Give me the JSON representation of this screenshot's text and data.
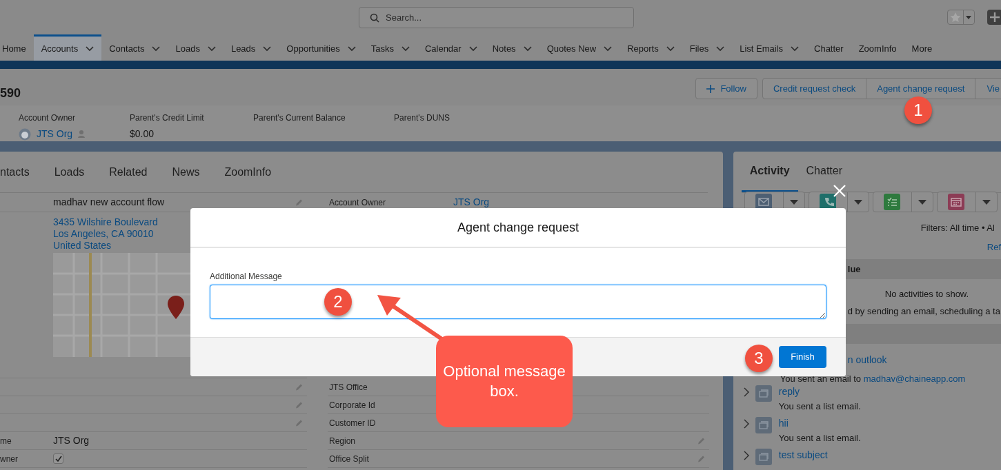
{
  "header": {
    "search": {
      "placeholder": "Search..."
    }
  },
  "nav": {
    "tabs": [
      {
        "label": "Home",
        "dropdown": false,
        "selected": false
      },
      {
        "label": "Accounts",
        "dropdown": true,
        "selected": true
      },
      {
        "label": "Contacts",
        "dropdown": true,
        "selected": false
      },
      {
        "label": "Loads",
        "dropdown": true,
        "selected": false
      },
      {
        "label": "Leads",
        "dropdown": true,
        "selected": false
      },
      {
        "label": "Opportunities",
        "dropdown": true,
        "selected": false
      },
      {
        "label": "Tasks",
        "dropdown": true,
        "selected": false
      },
      {
        "label": "Calendar",
        "dropdown": true,
        "selected": false
      },
      {
        "label": "Notes",
        "dropdown": true,
        "selected": false
      },
      {
        "label": "Quotes New",
        "dropdown": true,
        "selected": false
      },
      {
        "label": "Reports",
        "dropdown": true,
        "selected": false
      },
      {
        "label": "Files",
        "dropdown": true,
        "selected": false
      },
      {
        "label": "List Emails",
        "dropdown": true,
        "selected": false
      },
      {
        "label": "Chatter",
        "dropdown": false,
        "selected": false
      },
      {
        "label": "ZoomInfo",
        "dropdown": false,
        "selected": false
      },
      {
        "label": "More",
        "dropdown": false,
        "selected": false
      }
    ]
  },
  "record": {
    "title": "590",
    "actions": [
      {
        "label": "Follow",
        "kind": "follow"
      },
      {
        "label": "Credit request check",
        "kind": "action"
      },
      {
        "label": "Agent change request",
        "kind": "action"
      },
      {
        "label": "Vie",
        "kind": "action"
      }
    ],
    "highlights": [
      {
        "label": "Account Owner",
        "value": "JTS Org",
        "kind": "owner"
      },
      {
        "label": "Parent's Credit Limit",
        "value": "$0.00",
        "kind": "text"
      },
      {
        "label": "Parent's Current Balance",
        "kind": "text"
      },
      {
        "label": "Parent's DUNS",
        "kind": "text"
      }
    ]
  },
  "detail": {
    "tabs": [
      {
        "label": "ntacts",
        "selected": false
      },
      {
        "label": "Loads",
        "selected": false
      },
      {
        "label": "Related",
        "selected": false
      },
      {
        "label": "News",
        "selected": false
      },
      {
        "label": "ZoomInfo",
        "selected": false
      }
    ],
    "left_fields": [
      {
        "kind": "text",
        "value": "madhav new account flow",
        "editable": true
      },
      {
        "kind": "address",
        "lines": [
          "3435 Wilshire Boulevard",
          "Los Angeles, CA 90010",
          "United States"
        ]
      },
      {
        "kind": "text",
        "editable": true
      },
      {
        "kind": "text",
        "editable": true
      },
      {
        "kind": "text",
        "editable": true
      },
      {
        "kind": "text",
        "label": "me",
        "value": "JTS Org"
      },
      {
        "kind": "checkbox",
        "label": "wner",
        "checked": true
      }
    ],
    "right_fields": [
      {
        "kind": "link",
        "label": "Account Owner",
        "value": "JTS Org"
      },
      {
        "kind": "text",
        "label": "JTS Office"
      },
      {
        "kind": "text",
        "label": "Corporate Id"
      },
      {
        "kind": "text",
        "label": "Customer ID"
      },
      {
        "kind": "text",
        "label": "Region",
        "editable": true
      },
      {
        "kind": "text",
        "label": "Office Split",
        "editable": true
      }
    ]
  },
  "activity": {
    "tabs": [
      {
        "label": "Activity",
        "selected": true
      },
      {
        "label": "Chatter",
        "selected": false
      }
    ],
    "quick_actions": [
      {
        "kind": "email"
      },
      {
        "kind": "call"
      },
      {
        "kind": "task"
      },
      {
        "kind": "event"
      }
    ],
    "filters": "Filters: All time • Al",
    "refresh": "Ref",
    "section": "lue",
    "empty_title": "No activities to show.",
    "empty_hint": "d by sending an email, scheduling a ta",
    "items": [
      {
        "kind": "email",
        "title": "n outlook",
        "text": "You sent an email to ",
        "link": "madhav@chaineapp.com"
      },
      {
        "kind": "list_email",
        "title": "reply",
        "text": "You sent a list email."
      },
      {
        "kind": "list_email",
        "title": "hii",
        "text": "You sent a list email."
      },
      {
        "kind": "list_email",
        "title": "test subject"
      }
    ]
  },
  "modal": {
    "title": "Agent change request",
    "field_label": "Additional Message",
    "button": "Finish"
  },
  "annotations": [
    {
      "kind": "step",
      "label": "1"
    },
    {
      "kind": "step",
      "label": "2"
    },
    {
      "kind": "step",
      "label": "3"
    },
    {
      "kind": "callout",
      "text": "Optional message box."
    }
  ]
}
